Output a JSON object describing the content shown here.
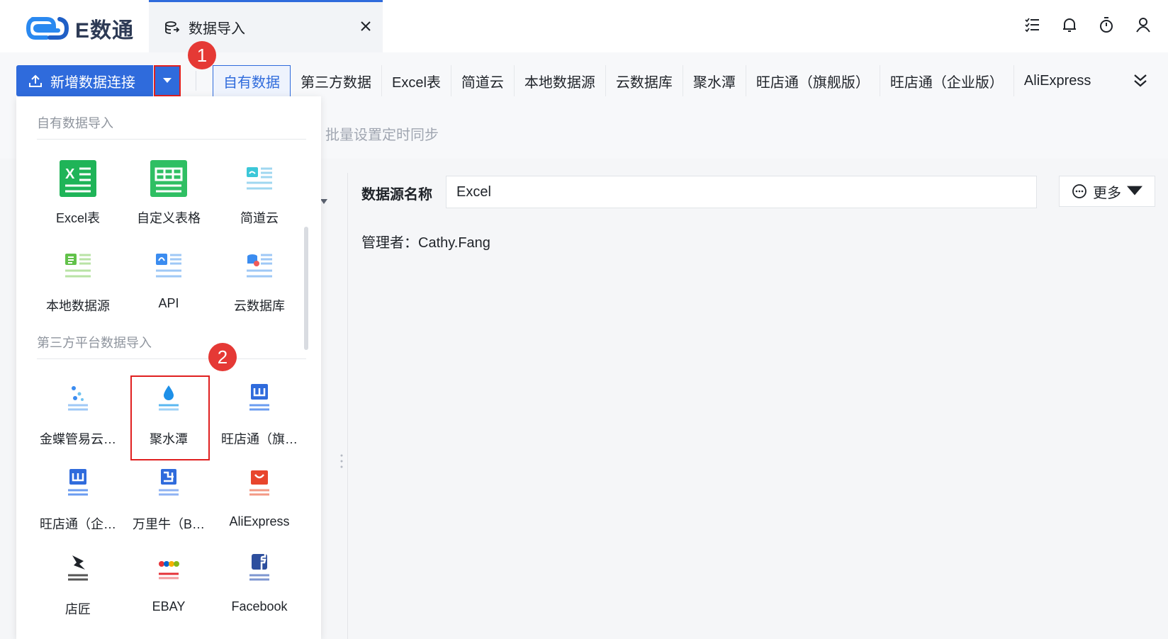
{
  "app": {
    "name": "E数通"
  },
  "tab": {
    "label": "数据导入"
  },
  "toolbar": {
    "new_button": "新增数据连接",
    "badge1": "1",
    "badge2": "2",
    "batch_sync": "批量设置定时同步"
  },
  "categories": [
    "自有数据",
    "第三方数据",
    "Excel表",
    "简道云",
    "本地数据源",
    "云数据库",
    "聚水潭",
    "旺店通（旗舰版）",
    "旺店通（企业版）",
    "AliExpress"
  ],
  "dropdown": {
    "section1": "自有数据导入",
    "section2": "第三方平台数据导入",
    "own": [
      {
        "label": "Excel表",
        "icon": "excel-icon"
      },
      {
        "label": "自定义表格",
        "icon": "custom-table-icon"
      },
      {
        "label": "简道云",
        "icon": "jiandaoyun-icon"
      },
      {
        "label": "本地数据源",
        "icon": "local-datasource-icon"
      },
      {
        "label": "API",
        "icon": "api-icon"
      },
      {
        "label": "云数据库",
        "icon": "cloud-database-icon"
      }
    ],
    "third": [
      {
        "label": "金蝶管易云…",
        "icon": "kingdee-icon"
      },
      {
        "label": "聚水潭",
        "icon": "jushuitan-icon"
      },
      {
        "label": "旺店通（旗…",
        "icon": "wangdiantong-flagship-icon"
      },
      {
        "label": "旺店通（企…",
        "icon": "wangdiantong-enterprise-icon"
      },
      {
        "label": "万里牛（B…",
        "icon": "wanliniu-icon"
      },
      {
        "label": "AliExpress",
        "icon": "aliexpress-icon"
      },
      {
        "label": "店匠",
        "icon": "shoplazza-icon"
      },
      {
        "label": "EBAY",
        "icon": "ebay-icon"
      },
      {
        "label": "Facebook",
        "icon": "facebook-icon"
      }
    ]
  },
  "detail": {
    "ds_name_label": "数据源名称",
    "ds_name_value": "Excel",
    "more_button": "更多",
    "manager": "管理者：Cathy.Fang"
  },
  "colors": {
    "primary": "#2f6bdc",
    "highlight": "#e02020",
    "badge": "#e53935"
  }
}
